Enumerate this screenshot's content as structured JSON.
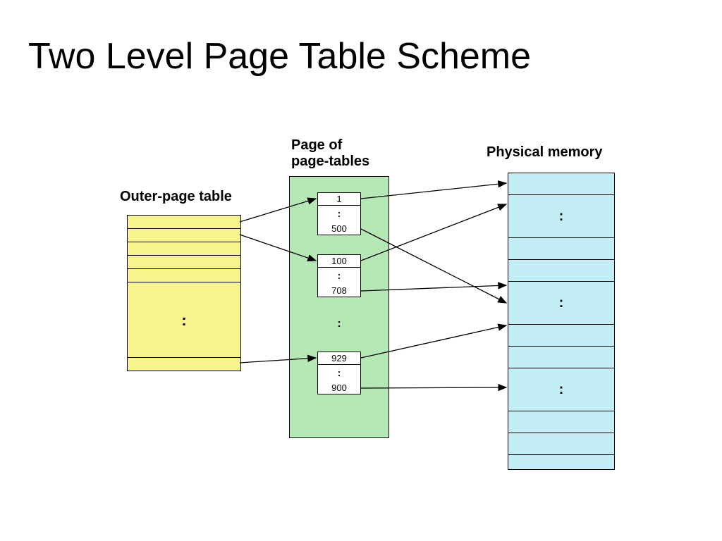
{
  "title": "Two Level Page Table Scheme",
  "labels": {
    "outer": "Outer-page table",
    "inner": "Page of\npage-tables",
    "phys": "Physical memory"
  },
  "outer_table": {
    "small_rows": 5,
    "ellipsis": ":"
  },
  "inner_tables": [
    {
      "top": "1",
      "bottom": "500"
    },
    {
      "top": "100",
      "bottom": "708"
    },
    {
      "top": "929",
      "bottom": "900"
    }
  ],
  "inner_ellipsis": ":",
  "phys_ellipsis": ":"
}
